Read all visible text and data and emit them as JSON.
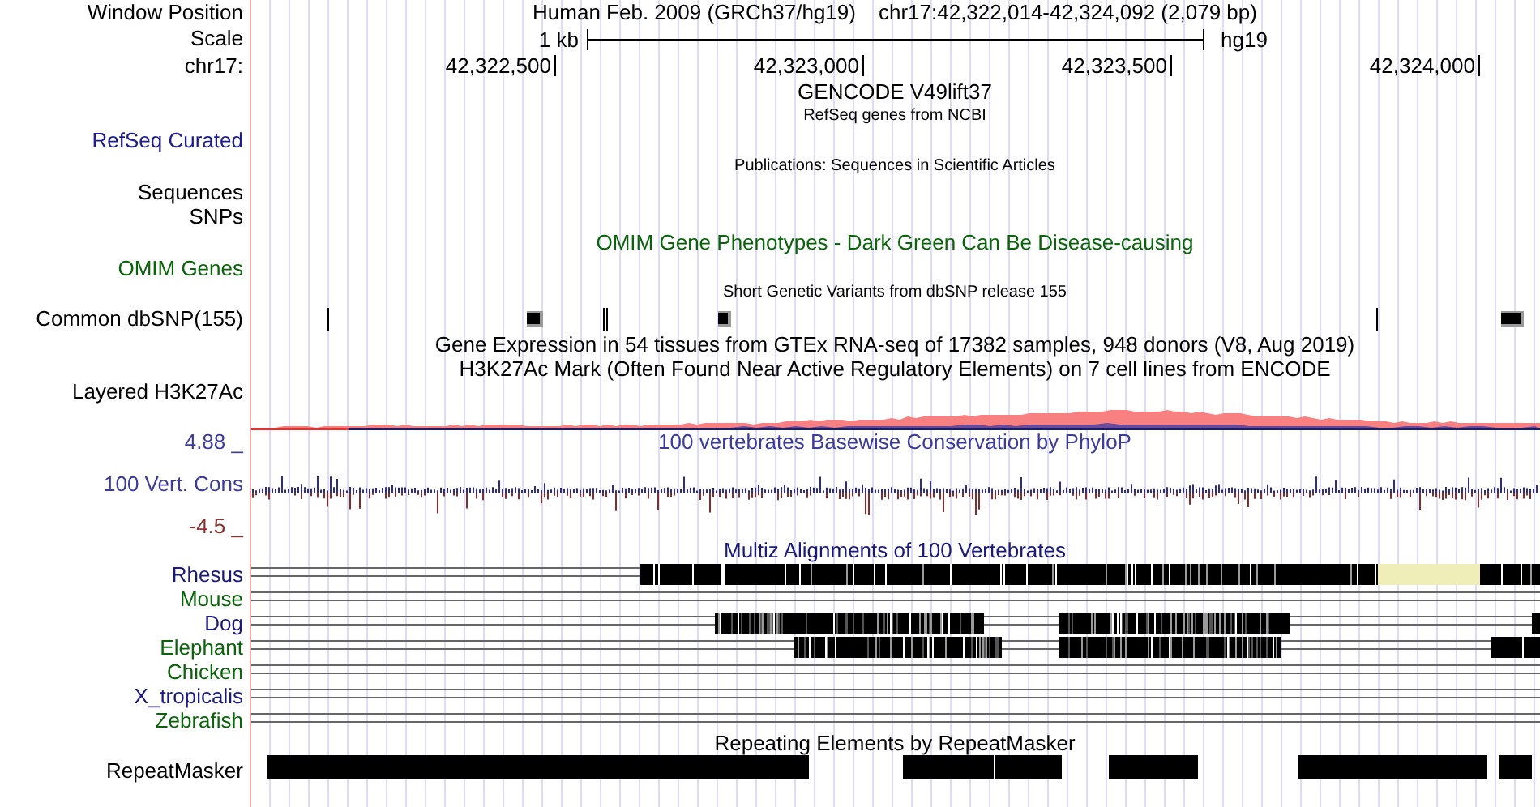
{
  "header": {
    "label": "Window Position",
    "assembly": "Human Feb. 2009 (GRCh37/hg19)",
    "position": "chr17:42,322,014-42,324,092 (2,079 bp)"
  },
  "scale": {
    "label": "Scale",
    "length": "1 kb",
    "assembly": "hg19"
  },
  "ruler": {
    "label": "chr17:",
    "ticks": [
      "42,322,500",
      "42,323,000",
      "42,323,500",
      "42,324,000"
    ]
  },
  "tracks": [
    {
      "kind": "genes",
      "title": "GENCODE V49lift37",
      "subtitle": "RefSeq genes from NCBI",
      "label": "RefSeq Curated",
      "color": "#1c1c8c"
    },
    {
      "kind": "publications",
      "title": "Publications: Sequences in Scientific Articles",
      "labels": [
        "Sequences",
        "SNPs"
      ]
    },
    {
      "kind": "omim",
      "title": {
        "text": "OMIM Gene Phenotypes - Dark Green Can Be Disease-causing",
        "color": "#0a640a"
      },
      "label": "OMIM Genes",
      "color": "#0a640a"
    },
    {
      "kind": "snp",
      "title": "Short Genetic Variants from dbSNP release 155",
      "label": "Common dbSNP(155)"
    },
    {
      "kind": "title-only",
      "title": "Gene Expression in 54 tissues from GTEx RNA-seq of 17382 samples, 948 donors (V8, Aug 2019)"
    },
    {
      "kind": "signal",
      "title": "H3K27Ac Mark (Often Found Near Active Regulatory Elements) on 7 cell lines from ENCODE",
      "label": "Layered H3K27Ac"
    },
    {
      "kind": "conservation",
      "title": {
        "text": "100 vertebrates Basewise Conservation by PhyloP",
        "color": "#3c3c9c"
      },
      "label": "100 Vert. Cons",
      "color": "#3c3c9c",
      "upper": "4.88 _",
      "lower": "-4.5 _"
    },
    {
      "kind": "multiz",
      "title": {
        "text": "Multiz Alignments of 100 Vertebrates",
        "color": "#1a1a7a"
      },
      "species": [
        {
          "name": "Rhesus",
          "color": "#1a1a7a"
        },
        {
          "name": "Mouse",
          "color": "#0a640a"
        },
        {
          "name": "Dog",
          "color": "#1a1a7a"
        },
        {
          "name": "Elephant",
          "color": "#0a640a"
        },
        {
          "name": "Chicken",
          "color": "#0a640a"
        },
        {
          "name": "X_tropicalis",
          "color": "#1a1a7a"
        },
        {
          "name": "Zebrafish",
          "color": "#0a640a"
        }
      ]
    },
    {
      "kind": "repeats",
      "title": "Repeating Elements by RepeatMasker",
      "label": "RepeatMasker"
    }
  ]
}
